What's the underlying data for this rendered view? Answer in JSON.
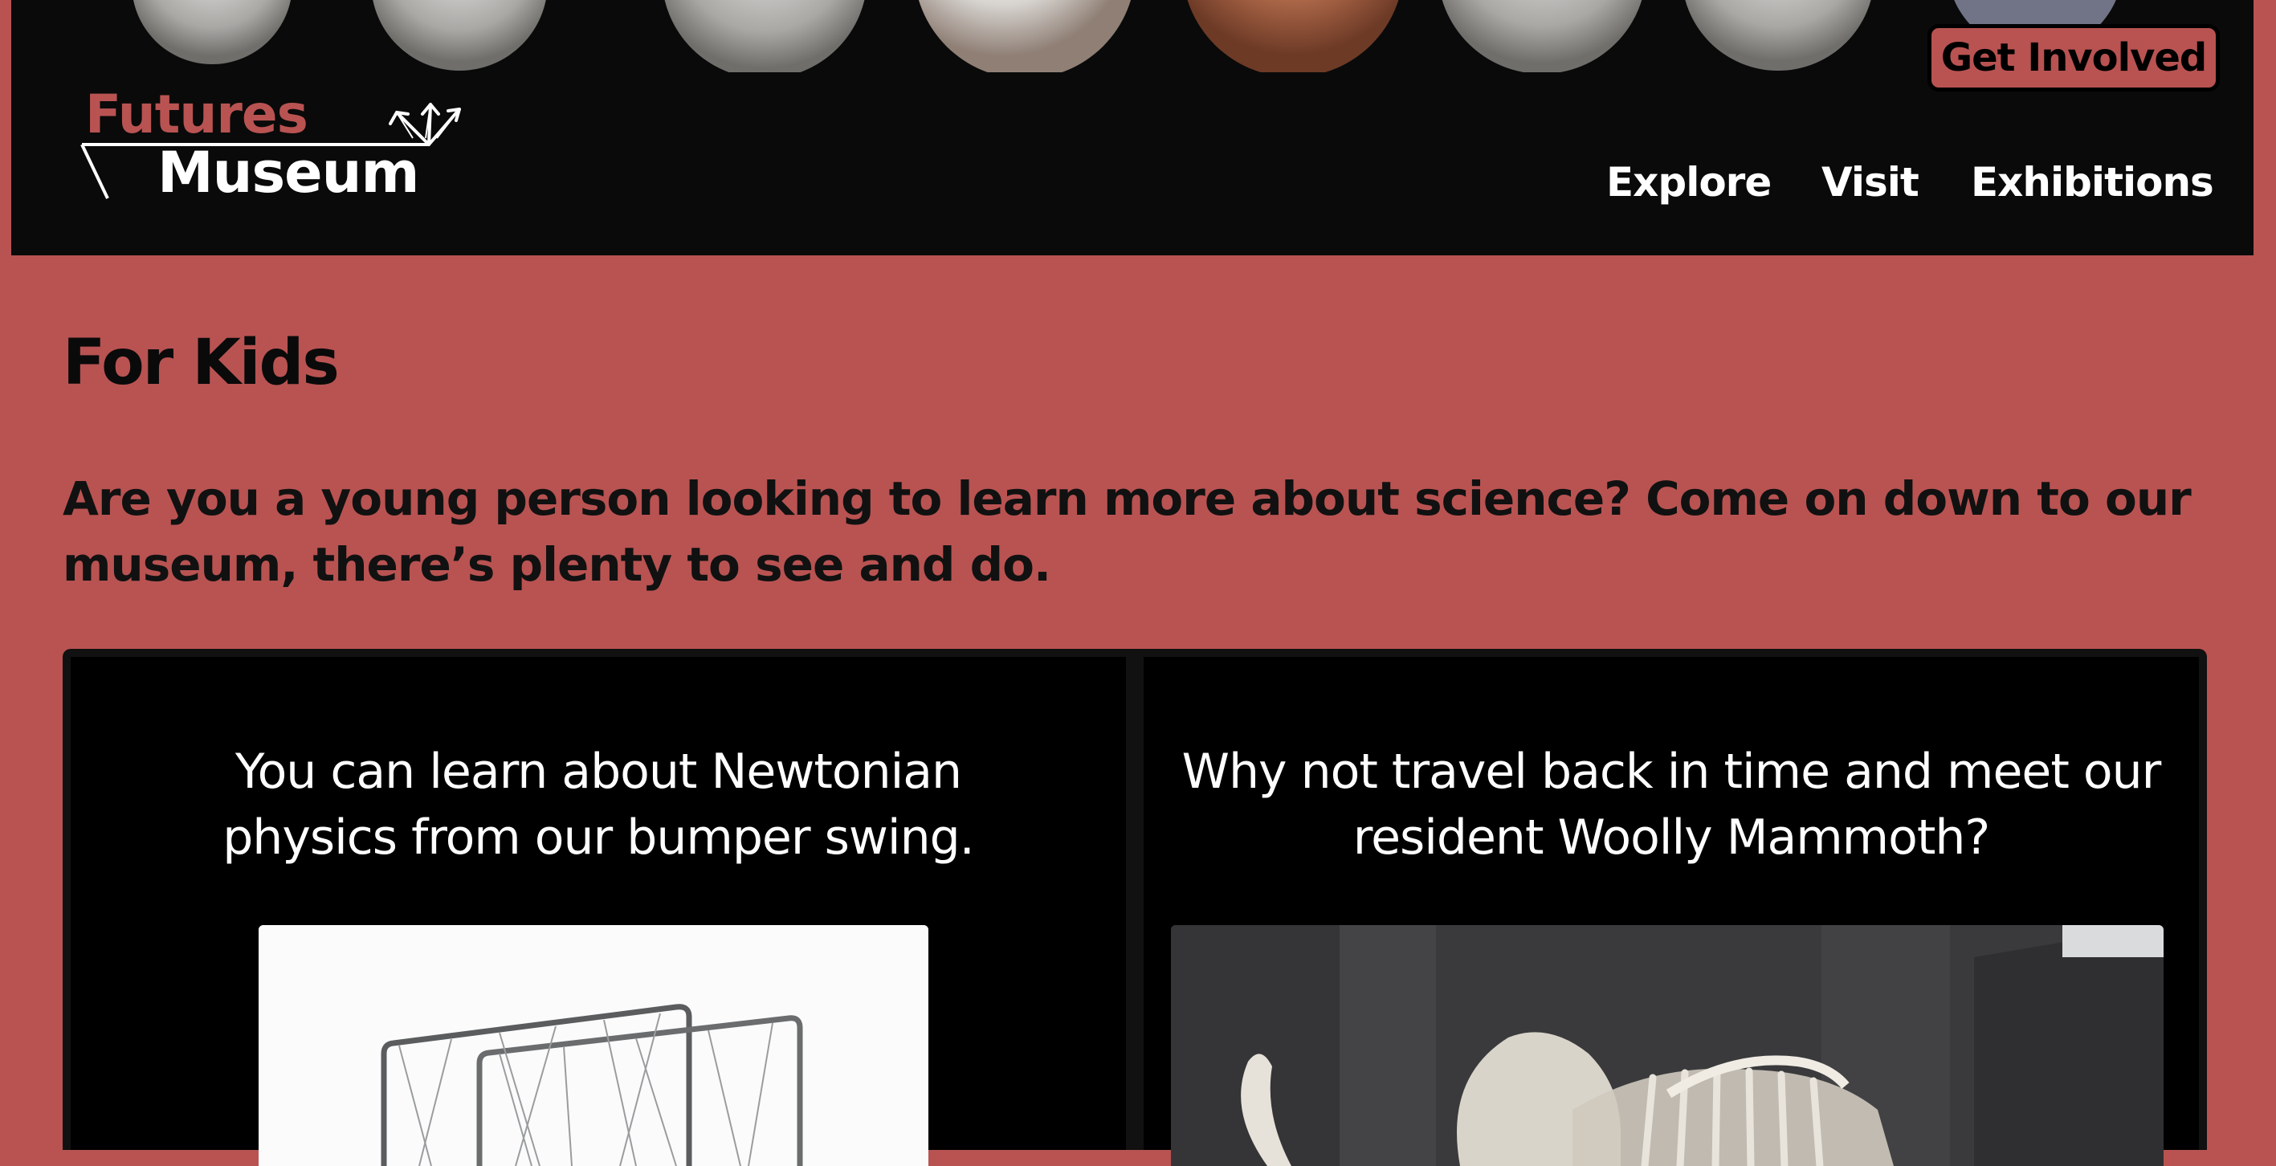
{
  "brand": {
    "line1": "Futures",
    "line2": "Museum",
    "accent_color": "#b85352",
    "header_bg": "#0a0a0a"
  },
  "header": {
    "cta_label": "Get Involved",
    "nav": [
      "Explore",
      "Visit",
      "Exhibitions"
    ],
    "banner": "lunar-eclipse-phases"
  },
  "main": {
    "title": "For Kids",
    "intro": "Are you a young person looking to learn more about science? Come on down to our museum, there’s plenty to see and do.",
    "cards": [
      {
        "text": "You can learn about Newtonian physics from our bumper swing.",
        "image": "bumper-swing-frame"
      },
      {
        "text": "Why not travel back in time and meet our resident Woolly Mammoth?",
        "image": "woolly-mammoth-skeleton"
      }
    ]
  }
}
